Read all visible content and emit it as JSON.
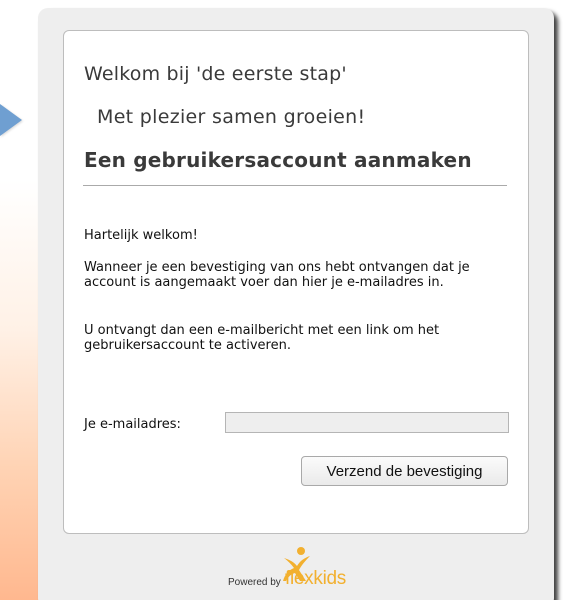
{
  "header": {
    "welcome_title": "Welkom bij 'de eerste stap'",
    "slogan": "Met plezier samen groeien!",
    "page_title": "Een gebruikersaccount aanmaken"
  },
  "content": {
    "greeting": "Hartelijk welkom!",
    "instruction": "Wanneer je een bevestiging van ons hebt ontvangen dat je account is aangemaakt voer dan hier je e-mailadres in.",
    "info": "U ontvangt dan een e-mailbericht met een link om het gebruikersaccount te activeren."
  },
  "form": {
    "email_label": "Je e-mailadres:",
    "email_value": "",
    "email_placeholder": "",
    "submit_label": "Verzend de bevestiging"
  },
  "footer": {
    "powered_by": "Powered by",
    "brand_name": "flexkids"
  },
  "colors": {
    "brand": "#f2b02f",
    "arrow": "#6f9fd1",
    "panel": "#eeeeee"
  },
  "icons": {
    "left_arrow": "arrow-right-icon",
    "brand_mark": "flexkids-person-icon"
  }
}
